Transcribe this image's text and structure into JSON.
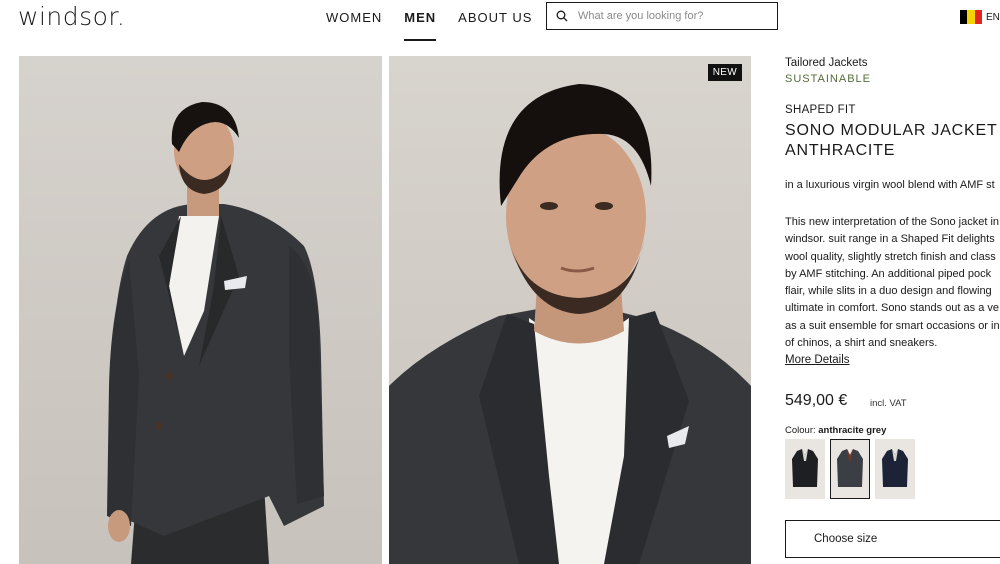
{
  "header": {
    "logo": "windsor.",
    "nav": [
      {
        "label": "WOMEN"
      },
      {
        "label": "MEN"
      },
      {
        "label": "ABOUT US"
      }
    ],
    "search_placeholder": "What are you looking for?",
    "language": "EN",
    "flag_colors": [
      "#000000",
      "#f5d300",
      "#e32423"
    ]
  },
  "gallery": {
    "badge": "NEW"
  },
  "product": {
    "category": "Tailored Jackets",
    "tag": "SUSTAINABLE",
    "fit": "SHAPED FIT",
    "name_line1": "SONO MODULAR JACKET",
    "name_line2": "ANTHRACITE",
    "subtitle": "in a luxurious virgin wool blend with AMF st",
    "description_lines": [
      "This new interpretation of the Sono jacket in",
      "windsor. suit range in a Shaped Fit delights",
      "wool quality, slightly stretch finish and class",
      "by AMF stitching. An additional piped pock",
      "flair, while slits in a duo design and flowing",
      "ultimate in comfort. Sono stands out as a ve",
      "as a suit ensemble for smart occasions or in",
      "of chinos, a shirt and sneakers."
    ],
    "more_details": "More Details",
    "price": "549,00 €",
    "vat": "incl. VAT",
    "colour_label": "Colour:",
    "colour_value": "anthracite grey",
    "swatch_colors": [
      "#1e1f22",
      "#3b3e44",
      "#1c2336"
    ],
    "size_button": "Choose size"
  }
}
